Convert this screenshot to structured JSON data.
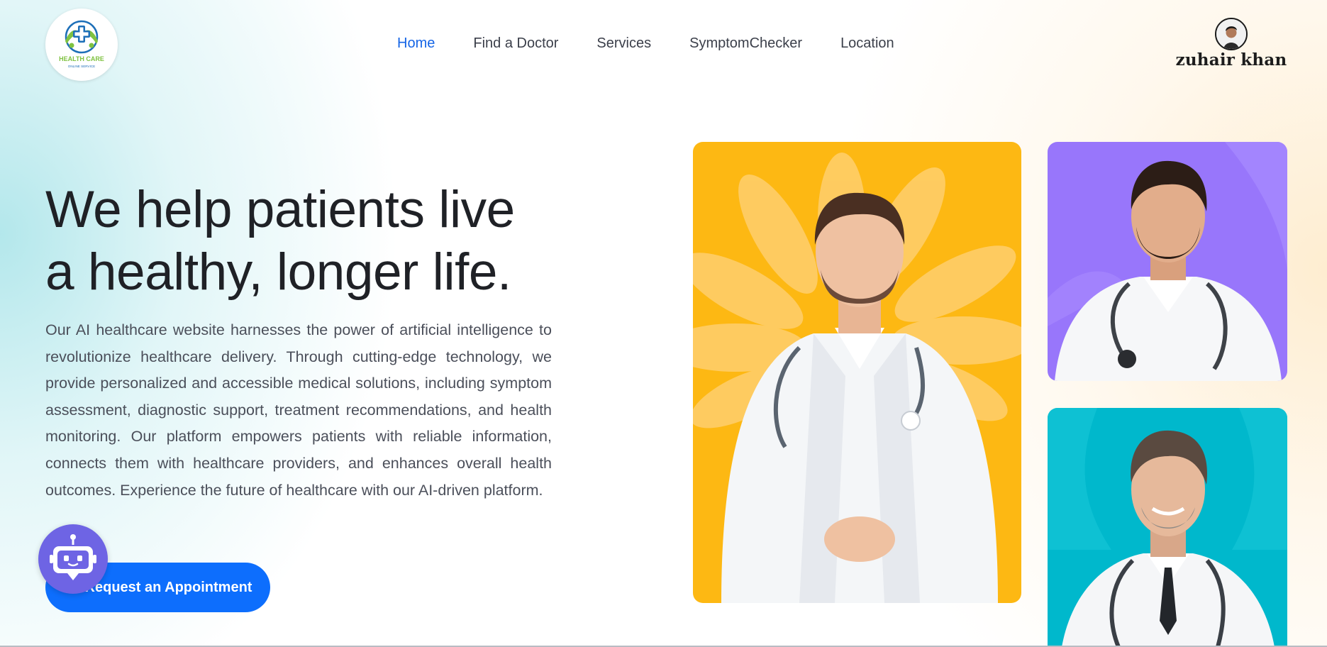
{
  "logo": {
    "title": "HEALTH CARE",
    "subtitle": "ONLINE SERVICE",
    "icon": "medical-cross-hands-icon"
  },
  "nav": {
    "items": [
      {
        "label": "Home",
        "active": true
      },
      {
        "label": "Find a Doctor",
        "active": false
      },
      {
        "label": "Services",
        "active": false
      },
      {
        "label": "SymptomChecker",
        "active": false
      },
      {
        "label": "Location",
        "active": false
      }
    ]
  },
  "profile": {
    "name": "zuhair khan",
    "icon": "user-avatar-icon"
  },
  "hero": {
    "title_line1": "We help patients live",
    "title_line2": "a healthy, longer life.",
    "description": "Our AI healthcare website harnesses the power of artificial intelligence to revolutionize healthcare delivery. Through cutting-edge technology, we provide personalized and accessible medical solutions, including symptom assessment, diagnostic support, treatment recommendations, and health monitoring. Our platform empowers patients with reliable information, connects them with healthcare providers, and enhances overall health outcomes. Experience the future of healthcare with our AI-driven platform.",
    "cta_label": "Request an Appointment"
  },
  "chatbot": {
    "icon": "robot-chat-icon"
  },
  "cards": [
    {
      "background": "#fdb813",
      "image": "doctor-photo-standing"
    },
    {
      "background": "#9876fb",
      "image": "doctor-photo-smiling"
    },
    {
      "background": "#00b8cc",
      "image": "doctor-photo-senior"
    }
  ],
  "colors": {
    "accent": "#0d6efd",
    "nav_active": "#1565e6",
    "heading": "#1f2126",
    "body_text": "#4b4f5a",
    "chatbot": "#6e64e4"
  }
}
